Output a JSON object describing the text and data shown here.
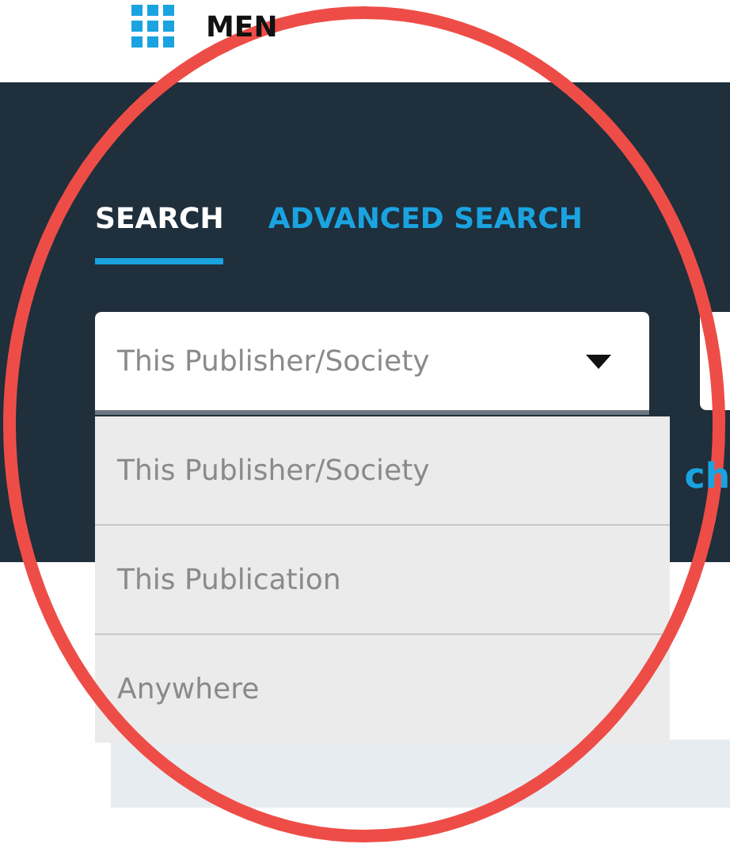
{
  "header": {
    "menu_label": "MEN"
  },
  "tabs": [
    {
      "label": "SEARCH",
      "selected": true
    },
    {
      "label": "ADVANCED SEARCH",
      "selected": false
    }
  ],
  "scope_select": {
    "value": "This Publisher/Society",
    "expanded": true,
    "options": [
      {
        "label": "This Publisher/Society"
      },
      {
        "label": "This Publication"
      },
      {
        "label": "Anywhere"
      }
    ]
  },
  "side_link": "ch"
}
